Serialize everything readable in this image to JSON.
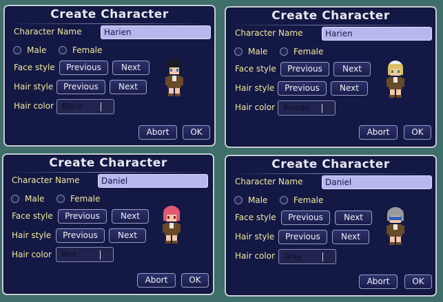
{
  "dialogs": [
    {
      "title": "Create Character",
      "name_label": "Character Name",
      "name_value": "Harien",
      "male_label": "Male",
      "female_label": "Female",
      "face_label": "Face style",
      "hair_label": "Hair style",
      "color_label": "Hair color",
      "prev_label": "Previous",
      "next_label": "Next",
      "hair_color_value": "Black",
      "abort_label": "Abort",
      "ok_label": "OK",
      "character_hair": "black"
    },
    {
      "title": "Create Character",
      "name_label": "Character Name",
      "name_value": "Harien",
      "male_label": "Male",
      "female_label": "Female",
      "face_label": "Face style",
      "hair_label": "Hair style",
      "color_label": "Hair color",
      "prev_label": "Previous",
      "next_label": "Next",
      "hair_color_value": "Blonde",
      "abort_label": "Abort",
      "ok_label": "OK",
      "character_hair": "blonde"
    },
    {
      "title": "Create Character",
      "name_label": "Character Name",
      "name_value": "Daniel",
      "male_label": "Male",
      "female_label": "Female",
      "face_label": "Face style",
      "hair_label": "Hair style",
      "color_label": "Hair color",
      "prev_label": "Previous",
      "next_label": "Next",
      "hair_color_value": "Red",
      "abort_label": "Abort",
      "ok_label": "OK",
      "character_hair": "red"
    },
    {
      "title": "Create Character",
      "name_label": "Character Name",
      "name_value": "Daniel",
      "male_label": "Male",
      "female_label": "Female",
      "face_label": "Face style",
      "hair_label": "Hair style",
      "color_label": "Hair color",
      "prev_label": "Previous",
      "next_label": "Next",
      "hair_color_value": "Gray",
      "abort_label": "Abort",
      "ok_label": "OK",
      "character_hair": "gray"
    }
  ],
  "colors": {
    "panel_bg": "#141844",
    "label_text": "#f2e8a0",
    "name_field_bg": "#b8b8ee",
    "hair_black": "#1a1a22",
    "hair_blonde": "#d8c060",
    "hair_red": "#e05870",
    "hair_gray": "#9a9a9a"
  }
}
